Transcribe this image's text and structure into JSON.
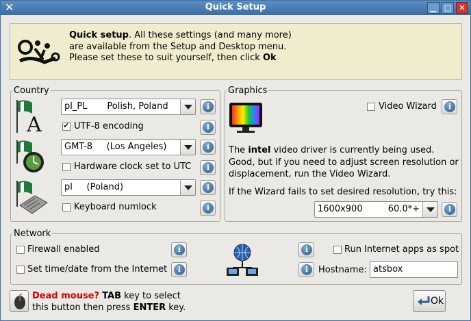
{
  "window": {
    "title": "Quick Setup"
  },
  "banner": {
    "line1_bold": "Quick setup",
    "line1_rest": ". All these settings (and many more)",
    "line2": "are available from the Setup and Desktop menu.",
    "line3_pre": "Please set these to suit yourself, then click ",
    "line3_bold": "Ok"
  },
  "country": {
    "legend": "Country",
    "locale_value": "pl_PL       Polish, Poland",
    "utf8_label": "UTF-8 encoding",
    "utf8_checked": true,
    "timezone_value": "GMT-8     (Los Angeles)",
    "hwclock_label": "Hardware clock set to UTC",
    "hwclock_checked": false,
    "keyboard_value": "pl     (Poland)",
    "numlock_label": "Keyboard numlock",
    "numlock_checked": false
  },
  "graphics": {
    "legend": "Graphics",
    "video_wizard_label": "Video Wizard",
    "video_wizard_checked": false,
    "desc_pre": "The ",
    "desc_bold": "intel",
    "desc_l1_rest": " video driver is currently being used.",
    "desc_l2": "Good, but if you need to adjust screen resolution or",
    "desc_l3": "displacement, run the Video Wizard.",
    "fail_text": "If the Wizard fails to set desired resolution, try this:",
    "resolution_value": "1600x900         60.0*+"
  },
  "network": {
    "legend": "Network",
    "firewall_label": "Firewall enabled",
    "firewall_checked": false,
    "timesync_label": "Set time/date from the Internet",
    "timesync_checked": false,
    "spot_label": "Run Internet apps as spot",
    "spot_checked": false,
    "hostname_label": "Hostname:",
    "hostname_value": "atsbox"
  },
  "footer": {
    "dead_mouse": "Dead mouse?",
    "tab_key": "TAB",
    "line1_rest": " key to select",
    "line2_pre": "this button then press ",
    "enter_key": "ENTER",
    "line2_post": " key.",
    "ok_label": "Ok"
  },
  "icons": {
    "info": "info-icon",
    "wizard": "wizard-logo-icon",
    "locale": "locale-flag-icon",
    "clock": "clock-flag-icon",
    "keyboard": "keyboard-flag-icon",
    "monitor": "monitor-icon",
    "network": "network-icon",
    "mouse": "mouse-icon",
    "ok": "ok-arrow-icon"
  },
  "colors": {
    "titlebar": "#4a7db4",
    "banner_bg": "#f0edcf",
    "info_blue": "#2c5b8d",
    "dead_mouse_red": "#d40000",
    "flag_green": "#1f7a3a"
  }
}
